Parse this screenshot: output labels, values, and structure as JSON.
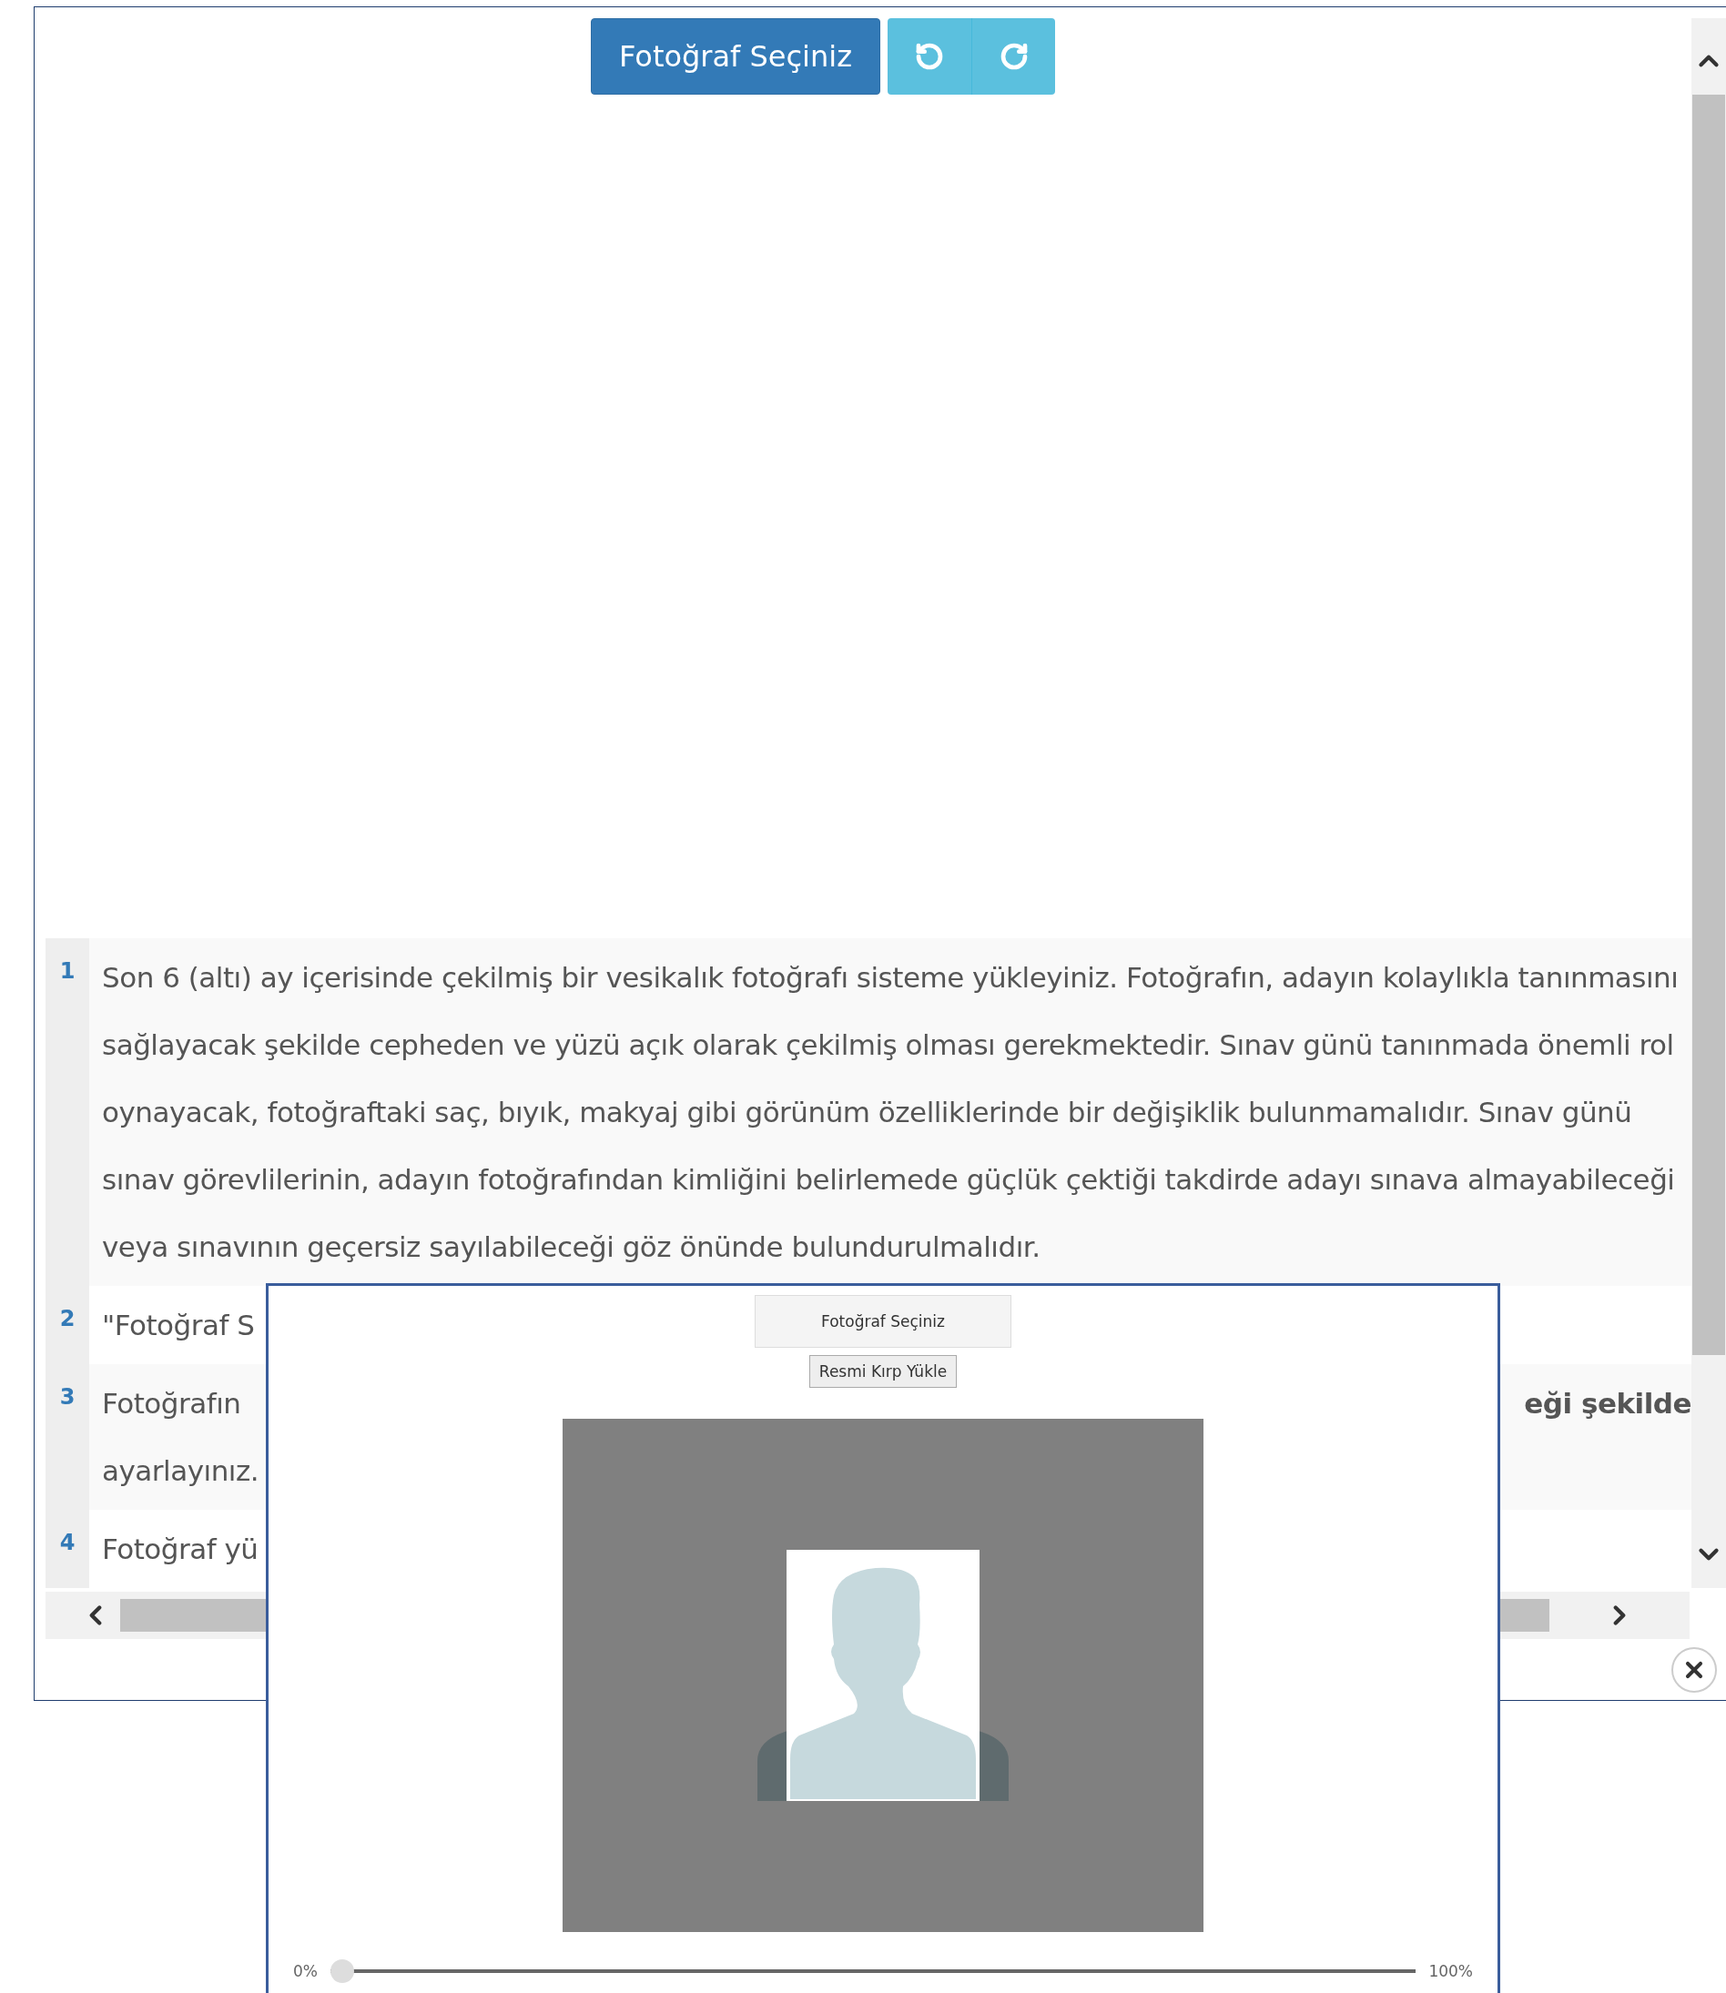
{
  "toolbar": {
    "select_button": "Fotoğraf Seçiniz"
  },
  "list": [
    {
      "number": "1",
      "lines": [
        "Son 6 (altı) ay içerisinde çekilmiş bir vesikalık fotoğrafı sisteme yükleyiniz. Fotoğrafın, adayın kolaylıkla tanınmasını",
        "sağlayacak şekilde cepheden ve yüzü açık olarak çekilmiş olması gerekmektedir. Sınav günü tanınmada önemli rol",
        "oynayacak, fotoğraftaki saç, bıyık, makyaj gibi görünüm özelliklerinde bir değişiklik bulunmamalıdır. Sınav günü",
        "sınav görevlilerinin, adayın fotoğrafından kimliğini belirlemede güçlük çektiği takdirde adayı sınava almayabileceği",
        "veya sınavının geçersiz sayılabileceği göz önünde bulundurulmalıdır."
      ]
    },
    {
      "number": "2",
      "lines": [
        "\"Fotoğraf S"
      ]
    },
    {
      "number": "3",
      "lines": [
        "Fotoğrafın",
        "ayarlayınız."
      ],
      "trailing": "eği şekilde"
    },
    {
      "number": "4",
      "lines": [
        "Fotoğraf yü"
      ]
    }
  ],
  "popup": {
    "select_button": "Fotoğraf Seçiniz",
    "crop_button": "Resmi Kırp Yükle",
    "zoom": {
      "min_label": "0%",
      "max_label": "100%",
      "level": 0
    }
  }
}
